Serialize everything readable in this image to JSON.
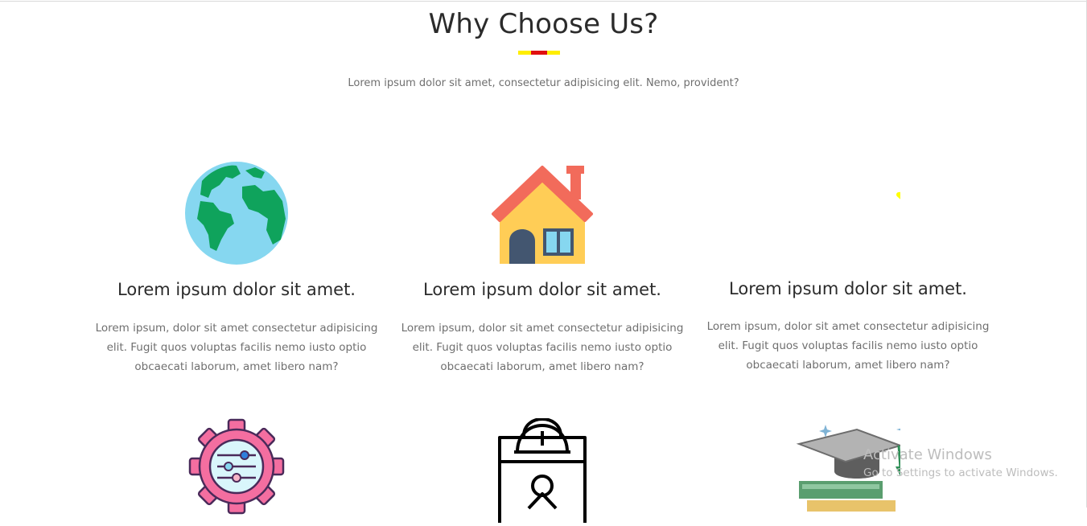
{
  "section": {
    "title": "Why Choose Us?",
    "subtitle": "Lorem ipsum dolor sit amet, consectetur adipisicing elit. Nemo, provident?",
    "underline_colors": [
      "#ffee00",
      "#e01010",
      "#ffee00"
    ]
  },
  "features": [
    {
      "icon": "globe-icon",
      "title": "Lorem ipsum dolor sit amet.",
      "text": "Lorem ipsum, dolor sit amet consectetur adipisicing elit. Fugit quos voluptas facilis nemo iusto optio obcaecati laborum, amet libero nam?"
    },
    {
      "icon": "house-icon",
      "title": "Lorem ipsum dolor sit amet.",
      "text": "Lorem ipsum, dolor sit amet consectetur adipisicing elit. Fugit quos voluptas facilis nemo iusto optio obcaecati laborum, amet libero nam?"
    },
    {
      "icon": "star-icon",
      "title": "Lorem ipsum dolor sit amet.",
      "text": "Lorem ipsum, dolor sit amet consectetur adipisicing elit. Fugit quos voluptas facilis nemo iusto optio obcaecati laborum, amet libero nam?"
    },
    {
      "icon": "settings-gear-icon"
    },
    {
      "icon": "id-badge-icon"
    },
    {
      "icon": "graduation-cap-books-icon"
    }
  ],
  "watermark": {
    "line1": "Activate Windows",
    "line2": "Go to Settings to activate Windows."
  }
}
